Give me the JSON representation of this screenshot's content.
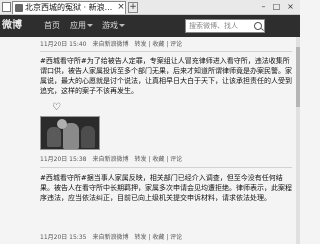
{
  "window": {
    "tab_title": "北京西城的冤狱 · 新浪...",
    "tab_close": "×",
    "tab_new": "+",
    "controls": [
      "–",
      "□",
      "×"
    ]
  },
  "header": {
    "brand": "微博",
    "nav": [
      "首页",
      "应用",
      "游戏"
    ],
    "search_placeholder": "搜索微博、找人"
  },
  "posts": [
    {
      "meta_time": "11月20日 15:40",
      "meta_source": "来自新浪微博",
      "meta_actions": "转发 | 收藏 | 评论"
    },
    {
      "body": "#西城看守所#为了给被告人定罪，专案组让人冒充律师进入看守所，违法收集所谓口供，被告人家属投诉至多个部门无果，后来才知道所谓律师竟是办案民警。家属说，最大的心愿就是讨个说法，让真相早日大白于天下，让该承担责任的人受到追究，这样的案子不该再发生。",
      "heart": "♡"
    },
    {
      "meta_time": "11月20日 15:38",
      "meta_source": "来自新浪微博",
      "meta_actions": "转发 | 收藏 | 评论"
    },
    {
      "body": "#西城看守所#据当事人家属反映，相关部门已经介入调查，但至今没有任何结果。被告人在看守所中长期羁押，家属多次申请会见均遭拒绝。律师表示，此案程序违法，应当依法纠正，目前已向上级机关提交申诉材料，请求依法处理。",
      "meta_time": "11月20日 15:35",
      "meta_source": "来自新浪微博",
      "meta_actions": "转发 | 收藏 | 评论"
    }
  ]
}
